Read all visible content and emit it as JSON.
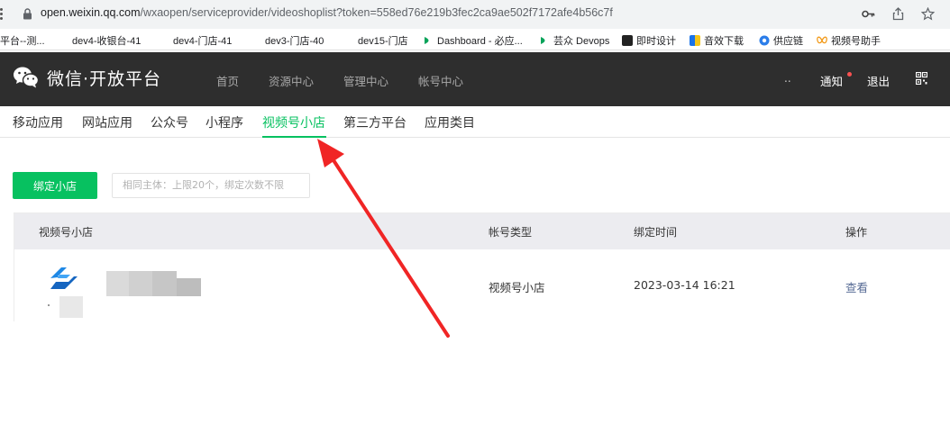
{
  "browser": {
    "url_host": "open.weixin.qq.com",
    "url_path": "/wxaopen/serviceprovider/videoshoplist?token=558ed76e219b3fec2ca9ae502f7172afe4b56c7f",
    "icons": [
      "lock-icon",
      "key-icon",
      "share-icon",
      "star-icon"
    ]
  },
  "bookmarks": [
    {
      "label": "平台--测...",
      "icon": "none"
    },
    {
      "label": "dev4-收银台-41",
      "icon": "none"
    },
    {
      "label": "dev4-门店-41",
      "icon": "none"
    },
    {
      "label": "dev3-门店-40",
      "icon": "none"
    },
    {
      "label": "dev15-门店",
      "icon": "none"
    },
    {
      "label": "Dashboard - 必应...",
      "icon": "green-dot-icon"
    },
    {
      "label": "芸众 Devops",
      "icon": "green-dot-icon"
    },
    {
      "label": "即时设计",
      "icon": "black-square-icon"
    },
    {
      "label": "音效下载",
      "icon": "blue-yellow-icon"
    },
    {
      "label": "供应链",
      "icon": "blue-circle-icon"
    },
    {
      "label": "视频号助手",
      "icon": "orange-butterfly-icon"
    }
  ],
  "header": {
    "brand": "微信·开放平台",
    "nav": [
      "首页",
      "资源中心",
      "管理中心",
      "帐号中心"
    ],
    "dots": "..",
    "notify": "通知",
    "logout": "退出"
  },
  "subnav": {
    "tabs": [
      "移动应用",
      "网站应用",
      "公众号",
      "小程序",
      "视频号小店",
      "第三方平台",
      "应用类目"
    ],
    "active_index": 4
  },
  "actions": {
    "bind_button": "绑定小店",
    "hint": "相同主体：上限20个，绑定次数不限"
  },
  "table": {
    "headers": [
      "视频号小店",
      "帐号类型",
      "绑定时间",
      "操作"
    ],
    "rows": [
      {
        "account_type": "视频号小店",
        "bind_time": "2023-03-14 16:21",
        "action": "查看"
      }
    ]
  },
  "colors": {
    "accent_green": "#07c160",
    "header_bg": "#2e2e2e",
    "link": "#576b95",
    "annotation_arrow": "#f02525"
  }
}
